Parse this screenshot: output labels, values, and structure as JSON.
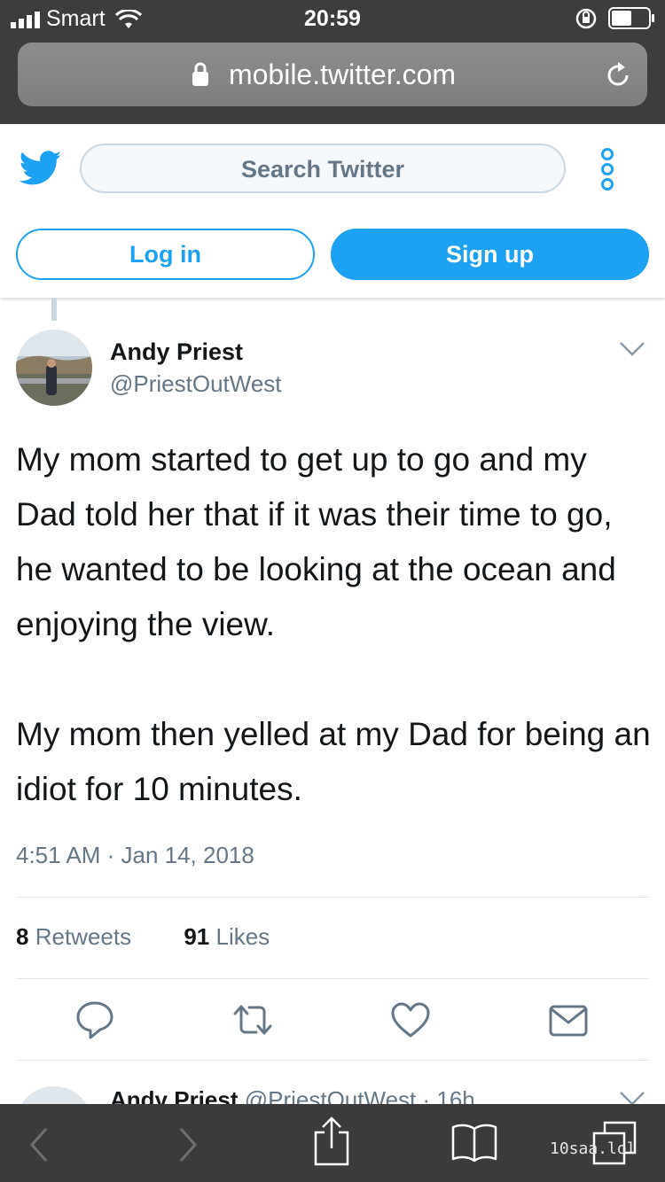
{
  "status_bar": {
    "carrier": "Smart",
    "time": "20:59"
  },
  "browser": {
    "url": "mobile.twitter.com",
    "icons": [
      "lock-icon",
      "reload-icon",
      "back-icon",
      "forward-icon",
      "share-icon",
      "bookmarks-icon",
      "tabs-icon"
    ]
  },
  "header": {
    "search_placeholder": "Search Twitter",
    "login_label": "Log in",
    "signup_label": "Sign up"
  },
  "tweet": {
    "author_name": "Andy Priest",
    "author_handle": "@PriestOutWest",
    "paragraph1": "My mom started to get up to go and my Dad told her that if it was their time to go, he wanted to be looking at the ocean and enjoying the view.",
    "paragraph2": "My mom then yelled at my Dad for being an idiot for 10 minutes.",
    "timestamp": "4:51 AM · Jan 14, 2018",
    "retweet_count": "8",
    "retweet_label": "Retweets",
    "like_count": "91",
    "like_label": "Likes"
  },
  "next_tweet": {
    "author_name": "Andy Priest",
    "handle_time": "@PriestOutWest · 16h"
  },
  "watermark": "10saa.lol",
  "colors": {
    "twitter_blue": "#1da1f2",
    "secondary_text": "#657786",
    "browser_chrome": "#3d3d3d"
  }
}
